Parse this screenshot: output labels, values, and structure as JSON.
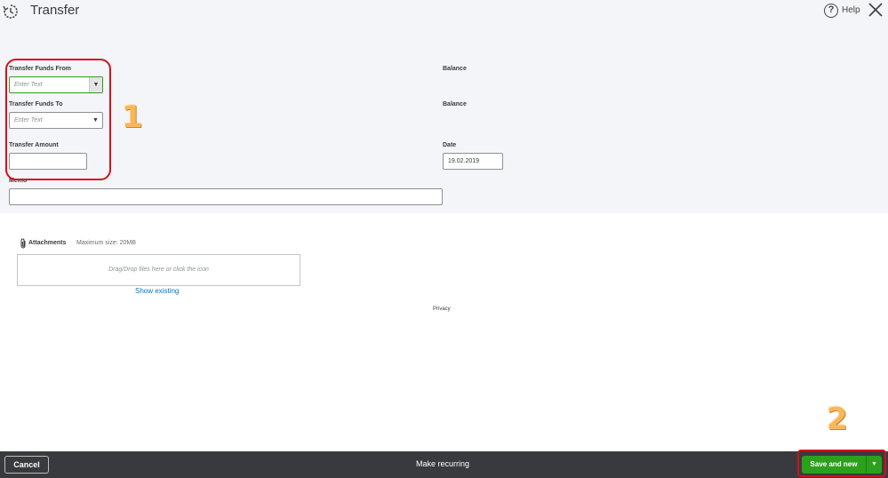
{
  "header": {
    "title": "Transfer",
    "help_label": "Help",
    "icons": [
      "recent-transactions-icon",
      "help-icon",
      "close-icon"
    ]
  },
  "form": {
    "from_label": "Transfer Funds From",
    "from_placeholder": "Enter Text",
    "to_label": "Transfer Funds To",
    "to_placeholder": "Enter Text",
    "amount_label": "Transfer Amount",
    "amount_value": "",
    "balance_from_label": "Balance",
    "balance_to_label": "Balance",
    "date_label": "Date",
    "date_value": "19.02.2019",
    "memo_label": "Memo",
    "memo_value": ""
  },
  "annotations": {
    "step1": "1",
    "step2": "2"
  },
  "attachments": {
    "label": "Attachments",
    "max_size": "Maximum size: 20MB",
    "dropzone_text": "Drag/Drop files here or click the icon",
    "show_existing": "Show existing"
  },
  "privacy_label": "Privacy",
  "footer": {
    "cancel_label": "Cancel",
    "make_recurring_label": "Make recurring",
    "save_label": "Save and new"
  },
  "colors": {
    "primary_green": "#2ca01c",
    "annotation_red": "#d1111b",
    "annotation_orange": "#f8b75a",
    "footer_bg": "#393a3d",
    "link_blue": "#0077c5"
  }
}
